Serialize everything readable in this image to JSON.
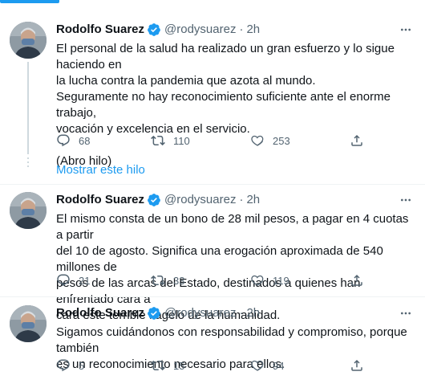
{
  "colors": {
    "accent": "#1d9bf0",
    "text": "#0f1419",
    "secondary": "#536471",
    "divider": "#eff3f4"
  },
  "show_thread_label": "Mostrar este hilo",
  "tweets": [
    {
      "name": "Rodolfo Suarez",
      "handle": "@rodysuarez",
      "dot": "·",
      "time": "2h",
      "text": "El personal de la salud ha realizado un gran esfuerzo y lo sigue haciendo en\nla lucha contra la pandemia que azota al mundo.\nSeguramente no hay reconocimiento suficiente ante el enorme trabajo,\nvocación y excelencia en el servicio.\n\n(Abro hilo)",
      "replies": "68",
      "retweets": "110",
      "likes": "253"
    },
    {
      "name": "Rodolfo Suarez",
      "handle": "@rodysuarez",
      "dot": "·",
      "time": "2h",
      "text": "El mismo consta de un bono de 28 mil pesos, a pagar en 4 cuotas a partir\ndel 10 de agosto. Significa una erogación aproximada de 540 millones de\npesos de las arcas del Estado, destinados a quienes han enfrentado cara a\ncara este terrible flagelo de la humanidad.",
      "replies": "21",
      "retweets": "33",
      "likes": "119"
    },
    {
      "name": "Rodolfo Suarez",
      "handle": "@rodysuarez",
      "dot": "·",
      "time": "2h",
      "text": "Sigamos cuidándonos con responsabilidad y compromiso, porque también\nes un reconocimiento necesario para ellos.",
      "replies": "5",
      "retweets": "15",
      "likes": "94"
    }
  ]
}
